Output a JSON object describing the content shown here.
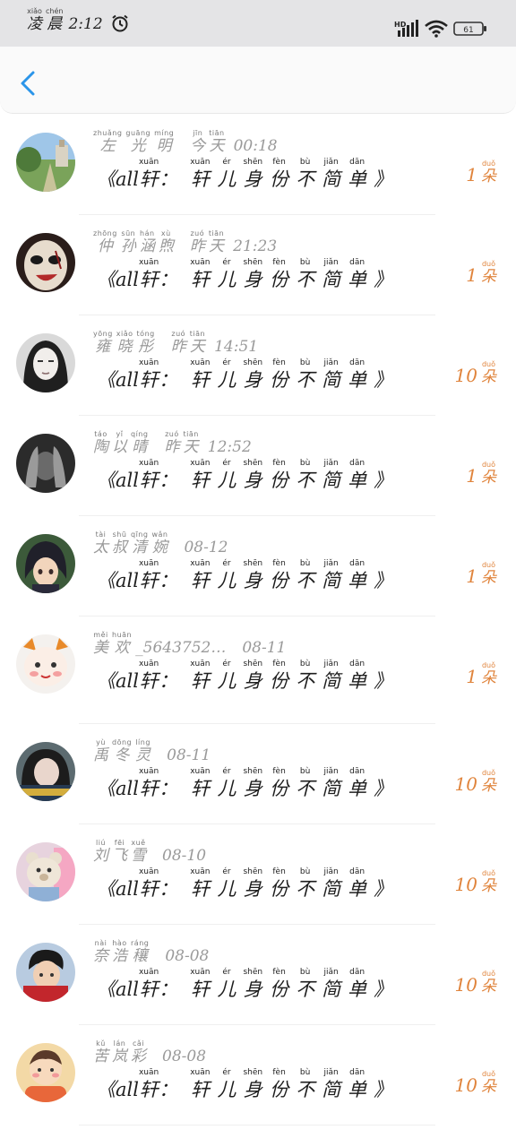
{
  "status_bar": {
    "carrier": [
      {
        "py": "xiǎo",
        "hz": "凌"
      },
      {
        "py": "chén",
        "hz": "晨"
      }
    ],
    "time": "2:12",
    "network": "HD",
    "battery": "61"
  },
  "messages": [
    {
      "name": [
        {
          "py": "zhuǎng",
          "hz": "左"
        },
        {
          "py": "guāng",
          "hz": "光"
        },
        {
          "py": "míng",
          "hz": "明"
        }
      ],
      "when": [
        {
          "py": "jīn",
          "hz": "今"
        },
        {
          "py": "tiān",
          "hz": "天"
        }
      ],
      "time": "00:18",
      "count": "1",
      "avatar": "park"
    },
    {
      "name": [
        {
          "py": "zhōng",
          "hz": "仲"
        },
        {
          "py": "sūn",
          "hz": "孙"
        },
        {
          "py": "hán",
          "hz": "涵"
        },
        {
          "py": "xù",
          "hz": "煦"
        }
      ],
      "when": [
        {
          "py": "zuó",
          "hz": "昨"
        },
        {
          "py": "tiān",
          "hz": "天"
        }
      ],
      "time": "21:23",
      "count": "1",
      "avatar": "mask"
    },
    {
      "name": [
        {
          "py": "yōng",
          "hz": "雍"
        },
        {
          "py": "xiǎo",
          "hz": "晓"
        },
        {
          "py": "tóng",
          "hz": "彤"
        }
      ],
      "when": [
        {
          "py": "zuó",
          "hz": "昨"
        },
        {
          "py": "tiān",
          "hz": "天"
        }
      ],
      "time": "14:51",
      "count": "10",
      "avatar": "girl-bw"
    },
    {
      "name": [
        {
          "py": "táo",
          "hz": "陶"
        },
        {
          "py": "yǐ",
          "hz": "以"
        },
        {
          "py": "qíng",
          "hz": "晴"
        }
      ],
      "when": [
        {
          "py": "zuó",
          "hz": "昨"
        },
        {
          "py": "tiān",
          "hz": "天"
        }
      ],
      "time": "12:52",
      "count": "1",
      "avatar": "hands"
    },
    {
      "name": [
        {
          "py": "tài",
          "hz": "太"
        },
        {
          "py": "shū",
          "hz": "叔"
        },
        {
          "py": "qīng",
          "hz": "清"
        },
        {
          "py": "wǎn",
          "hz": "婉"
        }
      ],
      "when": [],
      "time": "08-12",
      "count": "1",
      "avatar": "anime"
    },
    {
      "name": [
        {
          "py": "měi",
          "hz": "美"
        },
        {
          "py": "huān",
          "hz": "欢"
        },
        {
          "py": "",
          "hz": "_5643752…"
        }
      ],
      "when": [],
      "time": "08-11",
      "count": "1",
      "avatar": "cat"
    },
    {
      "name": [
        {
          "py": "yù",
          "hz": "禹"
        },
        {
          "py": "dōng",
          "hz": "冬"
        },
        {
          "py": "líng",
          "hz": "灵"
        }
      ],
      "when": [],
      "time": "08-11",
      "count": "10",
      "avatar": "girl-photo"
    },
    {
      "name": [
        {
          "py": "liú",
          "hz": "刘"
        },
        {
          "py": "fēi",
          "hz": "飞"
        },
        {
          "py": "xuě",
          "hz": "雪"
        }
      ],
      "when": [],
      "time": "08-10",
      "count": "10",
      "avatar": "bear"
    },
    {
      "name": [
        {
          "py": "nài",
          "hz": "奈"
        },
        {
          "py": "hào",
          "hz": "浩"
        },
        {
          "py": "ráng",
          "hz": "穰"
        }
      ],
      "when": [],
      "time": "08-08",
      "count": "10",
      "avatar": "boy"
    },
    {
      "name": [
        {
          "py": "kǔ",
          "hz": "苦"
        },
        {
          "py": "lán",
          "hz": "岚"
        },
        {
          "py": "cǎi",
          "hz": "彩"
        }
      ],
      "when": [],
      "time": "08-08",
      "count": "10",
      "avatar": "cartoon"
    }
  ],
  "message_text": [
    {
      "py": "",
      "hz": "《"
    },
    {
      "py": "",
      "hz": "all"
    },
    {
      "py": "xuān",
      "hz": "轩"
    },
    {
      "py": "",
      "hz": "："
    },
    {
      "py": "xuān",
      "hz": "轩"
    },
    {
      "py": "ér",
      "hz": "儿"
    },
    {
      "py": "shēn",
      "hz": "身"
    },
    {
      "py": "fèn",
      "hz": "份"
    },
    {
      "py": "bù",
      "hz": "不"
    },
    {
      "py": "jiǎn",
      "hz": "简"
    },
    {
      "py": "dān",
      "hz": "单"
    },
    {
      "py": "",
      "hz": "》"
    }
  ],
  "count_unit": {
    "py": "duǒ",
    "hz": "朵"
  },
  "colors": {
    "accent": "#2b95e9",
    "count": "#e0843c"
  }
}
